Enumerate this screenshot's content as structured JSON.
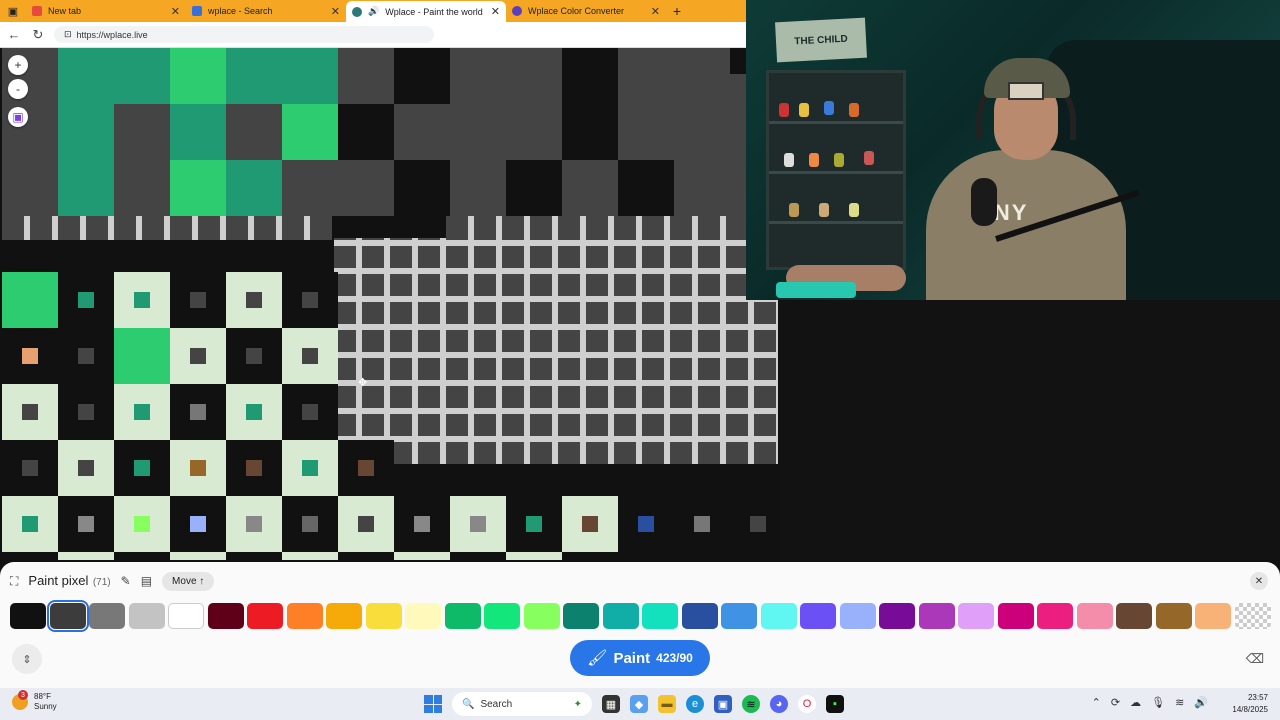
{
  "browser": {
    "tabs": [
      {
        "label": "New tab",
        "favicon_color": "#e84a3c",
        "active": false
      },
      {
        "label": "wplace - Search",
        "favicon_color": "#3b6fd8",
        "active": false
      },
      {
        "label": "Wplace - Paint the world",
        "favicon_color": "#2b7a78",
        "active": true
      },
      {
        "label": "Wplace Color Converter",
        "favicon_color": "#5b3fbf",
        "active": false
      }
    ],
    "url": "https://wplace.live"
  },
  "map_controls": {
    "zoom_in": "+",
    "zoom_out": "-"
  },
  "webcam": {
    "poster_text": "THE CHILD",
    "hoodie_text": "NNY"
  },
  "paint_panel": {
    "title": "Paint pixel",
    "count": "(71)",
    "move_label": "Move ↑",
    "paint_label": "Paint",
    "charges": "423/90",
    "palette": [
      "#111111",
      "#3c3c3c",
      "#787878",
      "#c3c3c3",
      "#ffffff",
      "#600018",
      "#ed1c24",
      "#ff7f27",
      "#f6aa09",
      "#f9dd3b",
      "#fffabc",
      "#0eb968",
      "#13e67b",
      "#87ff5e",
      "#0c816e",
      "#10aea6",
      "#13e1be",
      "#28509e",
      "#4093e4",
      "#60f7f2",
      "#6b50f6",
      "#99b1fb",
      "#780c99",
      "#aa38b9",
      "#e09ff9",
      "#cb007a",
      "#ec1f80",
      "#f38da9",
      "#684634",
      "#95682a",
      "#f8b277",
      "transparent"
    ],
    "selected_index": 1
  },
  "taskbar": {
    "temperature": "88°F",
    "condition": "Sunny",
    "weather_badge": "3",
    "search": "Search",
    "time": "23:57",
    "date": "14/8/2025"
  }
}
